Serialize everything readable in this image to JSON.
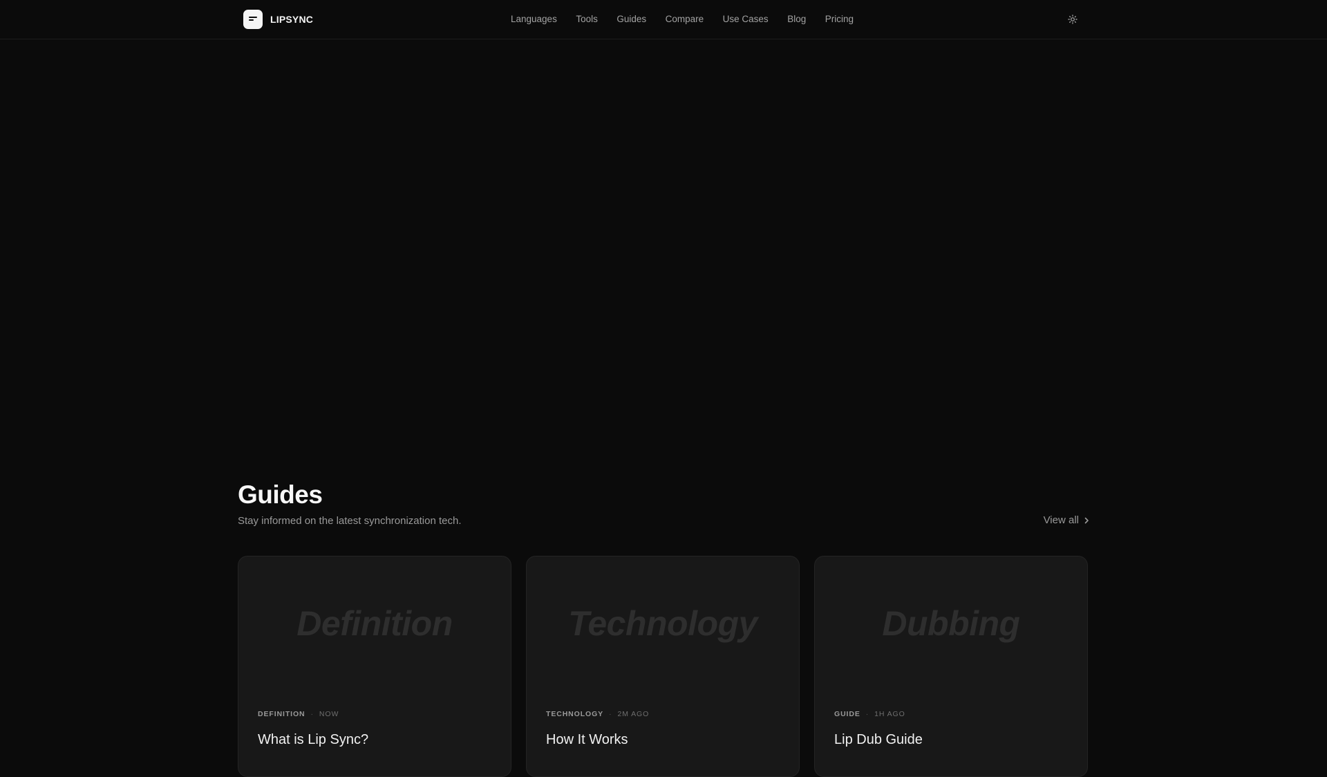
{
  "brand": {
    "name": "LIPSYNC"
  },
  "nav": {
    "items": [
      {
        "label": "Languages"
      },
      {
        "label": "Tools"
      },
      {
        "label": "Guides"
      },
      {
        "label": "Compare"
      },
      {
        "label": "Use Cases"
      },
      {
        "label": "Blog"
      },
      {
        "label": "Pricing"
      }
    ]
  },
  "theme_toggle": {
    "icon": "sun-icon"
  },
  "guides": {
    "title": "Guides",
    "subtitle": "Stay informed on the latest synchronization tech.",
    "view_all": "View all",
    "cards": [
      {
        "hero": "Definition",
        "category": "DEFINITION",
        "time": "NOW",
        "title": "What is Lip Sync?"
      },
      {
        "hero": "Technology",
        "category": "TECHNOLOGY",
        "time": "2M AGO",
        "title": "How It Works"
      },
      {
        "hero": "Dubbing",
        "category": "GUIDE",
        "time": "1H AGO",
        "title": "Lip Dub Guide"
      }
    ]
  },
  "colors": {
    "background": "#0b0b0b",
    "card": "#181818",
    "text_primary": "#f5f5f5",
    "text_muted": "#a3a3a3"
  }
}
